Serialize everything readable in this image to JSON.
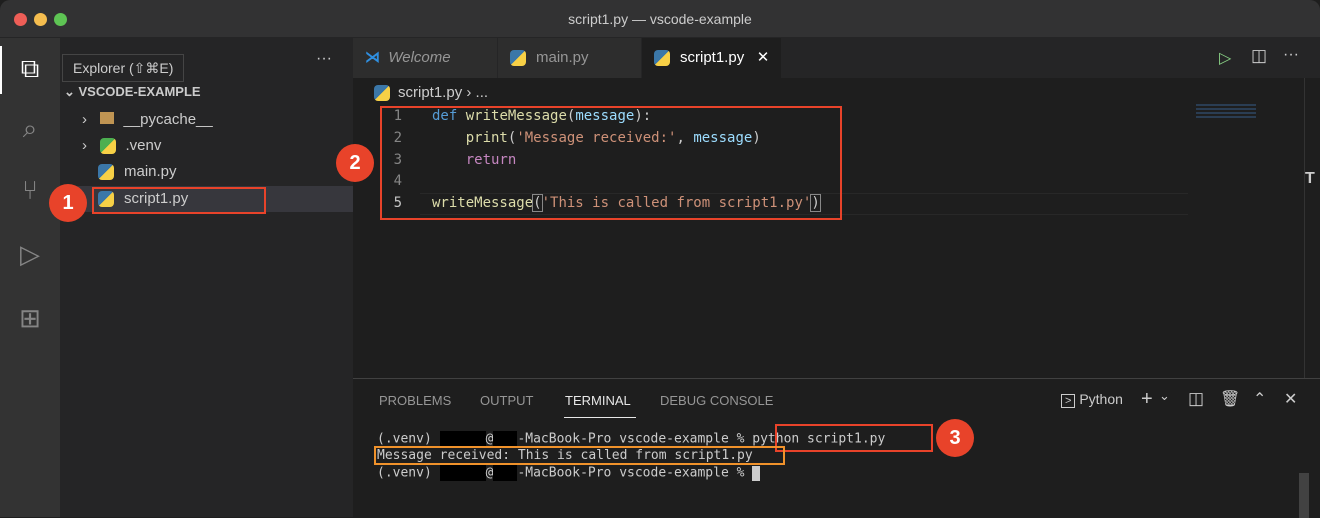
{
  "window": {
    "title": "script1.py — vscode-example"
  },
  "activity_bar": {
    "tooltip": "Explorer (⇧⌘E)"
  },
  "sidebar": {
    "more": "···",
    "root": "VSCODE-EXAMPLE",
    "items": [
      {
        "label": "__pycache__"
      },
      {
        "label": ".venv"
      },
      {
        "label": "main.py"
      },
      {
        "label": "script1.py"
      }
    ]
  },
  "tabs": [
    {
      "label": "Welcome"
    },
    {
      "label": "main.py"
    },
    {
      "label": "script1.py",
      "close": "✕"
    }
  ],
  "breadcrumb": {
    "file": "script1.py",
    "sep": "›",
    "rest": "..."
  },
  "editor": {
    "lines": [
      "1",
      "2",
      "3",
      "4",
      "5"
    ],
    "code": {
      "def": "def",
      "fn": "writeMessage",
      "p1": "(",
      "param": "message",
      "p2": "):",
      "print": "print",
      "s1": "'Message received:'",
      "comma": ", ",
      "arg": "message",
      "close": ")",
      "ret": "return",
      "call": "writeMessage",
      "callstr": "'This is called from script1.py'"
    }
  },
  "panel": {
    "tabs": [
      "PROBLEMS",
      "OUTPUT",
      "TERMINAL",
      "DEBUG CONSOLE"
    ],
    "shell": "Python",
    "plus": "+",
    "chev": "⌄",
    "terminal": {
      "prompt1a": "(.venv) ",
      "prompt1b": "@",
      "prompt1c": "-MacBook-Pro vscode-example % ",
      "cmd": "python script1.py",
      "output": "Message received: This is called from script1.py",
      "prompt2a": "(.venv) ",
      "prompt2b": "@",
      "prompt2c": "-MacBook-Pro vscode-example % "
    }
  },
  "annotations": [
    "1",
    "2",
    "3"
  ]
}
